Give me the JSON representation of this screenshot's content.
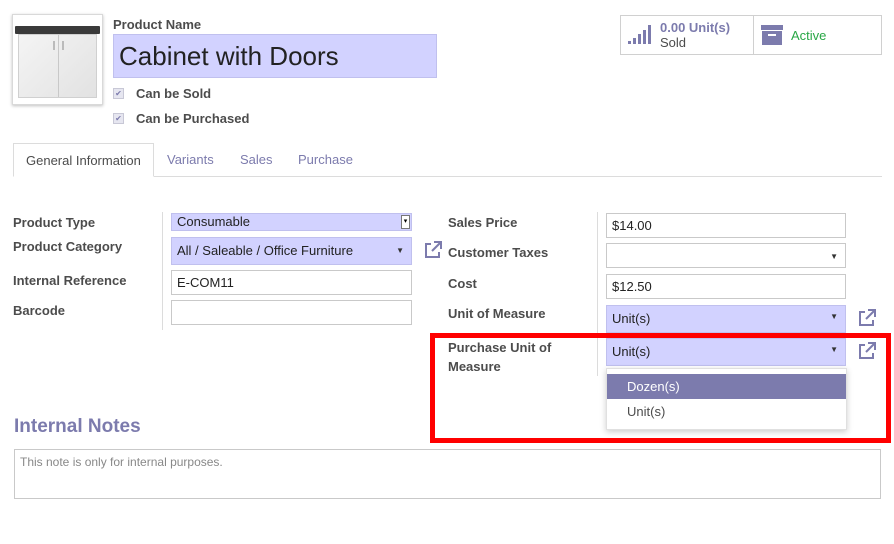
{
  "header": {
    "product_name_label": "Product Name",
    "product_name": "Cabinet with Doors",
    "can_be_sold_label": "Can be Sold",
    "can_be_purchased_label": "Can be Purchased",
    "can_be_sold": true,
    "can_be_purchased": true
  },
  "stats": {
    "sold_value": "0.00 Unit(s)",
    "sold_text": "Sold",
    "active_text": "Active"
  },
  "tabs": [
    {
      "label": "General Information",
      "active": true
    },
    {
      "label": "Variants"
    },
    {
      "label": "Sales"
    },
    {
      "label": "Purchase"
    }
  ],
  "left_fields": {
    "product_type_label": "Product Type",
    "product_type": "Consumable",
    "product_category_label": "Product Category",
    "product_category": "All / Saleable / Office Furniture",
    "internal_reference_label": "Internal Reference",
    "internal_reference": "E-COM11",
    "barcode_label": "Barcode",
    "barcode": ""
  },
  "right_fields": {
    "sales_price_label": "Sales Price",
    "sales_price": "$14.00",
    "customer_taxes_label": "Customer Taxes",
    "customer_taxes": "",
    "cost_label": "Cost",
    "cost": "$12.50",
    "uom_label": "Unit of Measure",
    "uom": "Unit(s)",
    "purchase_uom_label_1": "Purchase Unit of",
    "purchase_uom_label_2": "Measure",
    "purchase_uom": "Unit(s)"
  },
  "dropdown": {
    "options": [
      "Dozen(s)",
      "Unit(s)"
    ],
    "highlighted": "Dozen(s)"
  },
  "notes": {
    "title": "Internal Notes",
    "placeholder": "This note is only for internal purposes."
  },
  "icons": {
    "external_link": "external-link-icon",
    "bar_chart": "bar-chart-icon",
    "archive": "archive-icon",
    "checkmark": "check-icon",
    "caret": "caret-down-icon"
  },
  "colors": {
    "accent": "#7c7bad",
    "required_bg": "#d2d2ff",
    "active_green": "#28a745",
    "highlight_red": "#ff0000"
  }
}
